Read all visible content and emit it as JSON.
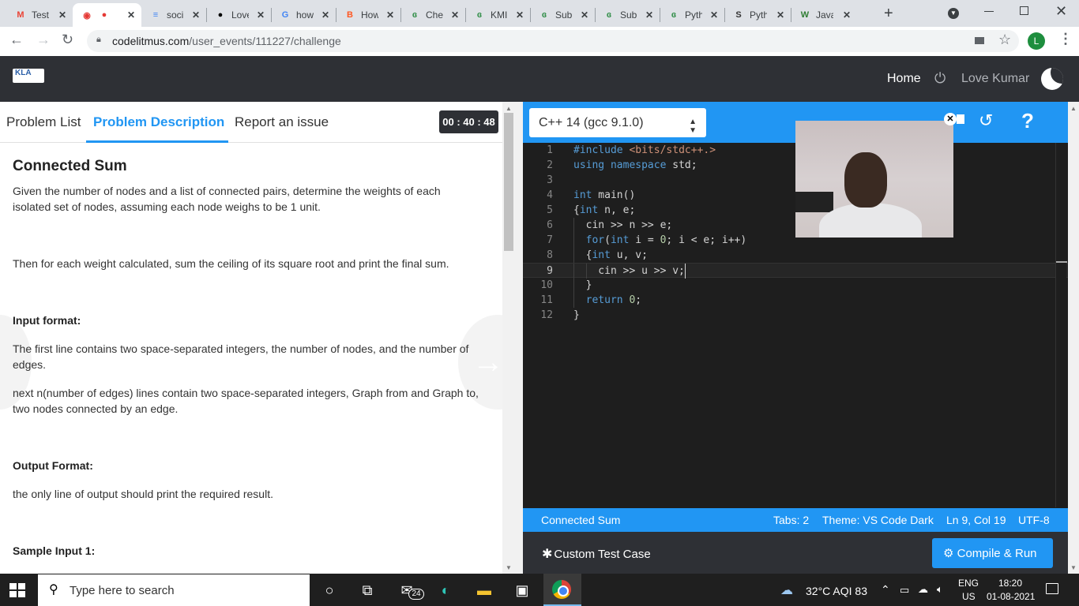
{
  "browser": {
    "tabs": [
      {
        "title": "Test",
        "icon": "gmail-icon",
        "icon_text": "M",
        "icon_color": "#ea4335",
        "active": false
      },
      {
        "title": "",
        "icon": "codelitmus-icon",
        "icon_text": "◉",
        "icon_color": "#e53935",
        "active": true
      },
      {
        "title": "soci",
        "icon": "google-docs-icon",
        "icon_text": "≡",
        "icon_color": "#4285f4",
        "active": false
      },
      {
        "title": "Love",
        "icon": "github-icon",
        "icon_text": "●",
        "icon_color": "#000000",
        "active": false
      },
      {
        "title": "how",
        "icon": "google-icon",
        "icon_text": "G",
        "icon_color": "#4285f4",
        "active": false
      },
      {
        "title": "How",
        "icon": "blogger-icon",
        "icon_text": "B",
        "icon_color": "#ff5722",
        "active": false
      },
      {
        "title": "Che",
        "icon": "geeksforgeeks-icon",
        "icon_text": "ɞ",
        "icon_color": "#2f8d46",
        "active": false
      },
      {
        "title": "KMI",
        "icon": "geeksforgeeks-icon",
        "icon_text": "ɞ",
        "icon_color": "#2f8d46",
        "active": false
      },
      {
        "title": "Sub",
        "icon": "geeksforgeeks-icon",
        "icon_text": "ɞ",
        "icon_color": "#2f8d46",
        "active": false
      },
      {
        "title": "Sub",
        "icon": "geeksforgeeks-icon",
        "icon_text": "ɞ",
        "icon_color": "#2f8d46",
        "active": false
      },
      {
        "title": "Pyth",
        "icon": "geeksforgeeks-icon",
        "icon_text": "ɞ",
        "icon_color": "#2f8d46",
        "active": false
      },
      {
        "title": "Pyth",
        "icon": "sanfoundry-icon",
        "icon_text": "S",
        "icon_color": "#333333",
        "active": false
      },
      {
        "title": "Java",
        "icon": "w3schools-icon",
        "icon_text": "W",
        "icon_color": "#2e7d32",
        "active": false
      }
    ],
    "url_domain": "codelitmus.com",
    "url_path": "/user_events/111227/challenge",
    "profile_initial": "L"
  },
  "header": {
    "logo_text": "KLA",
    "home_label": "Home",
    "user_name": "Love Kumar"
  },
  "left_panel": {
    "tabs": {
      "problem_list": "Problem List",
      "problem_description": "Problem Description",
      "report": "Report an issue"
    },
    "timer": "00 : 40 : 48",
    "title": "Connected Sum",
    "desc1": "Given the number of nodes and a list of connected pairs, determine the weights of each isolated set of nodes, assuming each node weighs to be 1 unit.",
    "desc2": "Then for each weight calculated, sum the ceiling of its square root and print the final sum.",
    "input_heading": "Input format:",
    "input1": "The first line contains two space-separated integers, the number of nodes, and the number of edges.",
    "input2": "next n(number of edges) lines contain two space-separated integers, Graph from and Graph to, two nodes connected by an edge.",
    "output_heading": "Output Format:",
    "output1": "the only line of output should print the required result.",
    "sample_heading": "Sample Input 1:"
  },
  "editor": {
    "language": "C++ 14 (gcc 9.1.0)",
    "lines": [
      {
        "n": "1",
        "text": "#include <bits/stdc++.>"
      },
      {
        "n": "2",
        "text": "using namespace std;"
      },
      {
        "n": "3",
        "text": ""
      },
      {
        "n": "4",
        "text": "int main()"
      },
      {
        "n": "5",
        "text": "{int n, e;"
      },
      {
        "n": "6",
        "text": "  cin >> n >> e;"
      },
      {
        "n": "7",
        "text": "  for(int i = 0; i < e; i++)"
      },
      {
        "n": "8",
        "text": "  {int u, v;"
      },
      {
        "n": "9",
        "text": "    cin >> u >> v;"
      },
      {
        "n": "10",
        "text": "  }"
      },
      {
        "n": "11",
        "text": "  return 0;"
      },
      {
        "n": "12",
        "text": "}"
      }
    ],
    "current_line": 9,
    "status": {
      "problem": "Connected Sum",
      "tabs": "Tabs: 2",
      "theme": "Theme: VS Code Dark",
      "position": "Ln 9, Col 19",
      "encoding": "UTF-8"
    },
    "custom_test_label": "Custom Test Case",
    "compile_label": "Compile & Run"
  },
  "taskbar": {
    "search_placeholder": "Type here to search",
    "mail_badge": "24",
    "weather": "32°C  AQI 83",
    "lang_top": "ENG",
    "lang_bottom": "US",
    "time": "18:20",
    "date": "01-08-2021"
  },
  "colors": {
    "accent": "#2196f3",
    "header_bg": "#2e3035",
    "editor_bg": "#1e1e1e"
  }
}
